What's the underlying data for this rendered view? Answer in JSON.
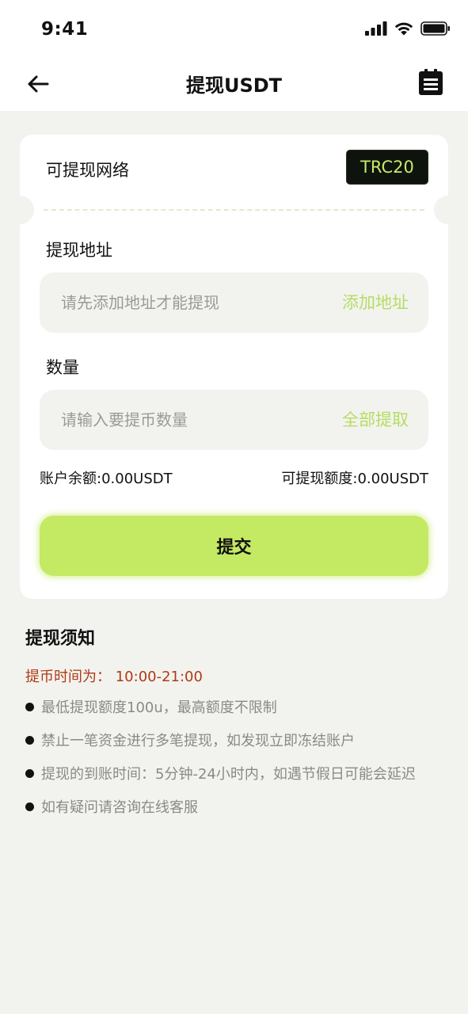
{
  "status_bar": {
    "time": "9:41"
  },
  "nav": {
    "title": "提现USDT"
  },
  "network": {
    "label": "可提现网络",
    "value": "TRC20"
  },
  "address": {
    "label": "提现地址",
    "placeholder": "请先添加地址才能提现",
    "action": "添加地址"
  },
  "amount": {
    "label": "数量",
    "placeholder": "请输入要提币数量",
    "action": "全部提取"
  },
  "balance": {
    "account": "账户余额:0.00USDT",
    "limit": "可提现额度:0.00USDT"
  },
  "submit_label": "提交",
  "notice": {
    "title": "提现须知",
    "time_text": "提币时间为：  10:00-21:00",
    "items": [
      "最低提现额度100u，最高额度不限制",
      "禁止一笔资金进行多笔提现，如发现立即冻结账户",
      "提现的到账时间：5分钟-24小时内，如遇节假日可能会延迟",
      "如有疑问请咨询在线客服"
    ]
  },
  "colors": {
    "accent": "#c4e963",
    "accent_text": "#b6dc63",
    "warning": "#b03a14",
    "background": "#f2f3ef",
    "badge_bg": "#0f130d"
  },
  "icons": [
    "signal-icon",
    "wifi-icon",
    "battery-icon",
    "back-arrow-icon",
    "record-list-icon"
  ]
}
